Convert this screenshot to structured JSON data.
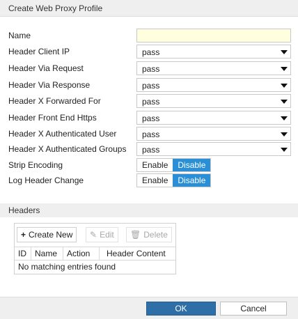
{
  "dialog": {
    "title": "Create Web Proxy Profile"
  },
  "fields": {
    "name": {
      "label": "Name",
      "value": "",
      "placeholder": ""
    },
    "header_client_ip": {
      "label": "Header Client IP",
      "value": "pass"
    },
    "header_via_request": {
      "label": "Header Via Request",
      "value": "pass"
    },
    "header_via_response": {
      "label": "Header Via Response",
      "value": "pass"
    },
    "header_x_forwarded_for": {
      "label": "Header X Forwarded For",
      "value": "pass"
    },
    "header_front_end_https": {
      "label": "Header Front End Https",
      "value": "pass"
    },
    "header_x_authenticated_user": {
      "label": "Header X Authenticated User",
      "value": "pass"
    },
    "header_x_authenticated_groups": {
      "label": "Header X Authenticated Groups",
      "value": "pass"
    },
    "strip_encoding": {
      "label": "Strip Encoding",
      "enable_label": "Enable",
      "disable_label": "Disable",
      "selected": "Disable"
    },
    "log_header_change": {
      "label": "Log Header Change",
      "enable_label": "Enable",
      "disable_label": "Disable",
      "selected": "Disable"
    }
  },
  "headers": {
    "section_title": "Headers",
    "toolbar": {
      "create_new": "Create New",
      "edit": "Edit",
      "delete": "Delete"
    },
    "columns": [
      "ID",
      "Name",
      "Action",
      "Header Content"
    ],
    "empty_message": "No matching entries found"
  },
  "footer": {
    "ok": "OK",
    "cancel": "Cancel"
  },
  "colors": {
    "accent": "#2b8fd6",
    "ok_button": "#2e6fa8",
    "name_input_bg": "#ffffe0"
  }
}
